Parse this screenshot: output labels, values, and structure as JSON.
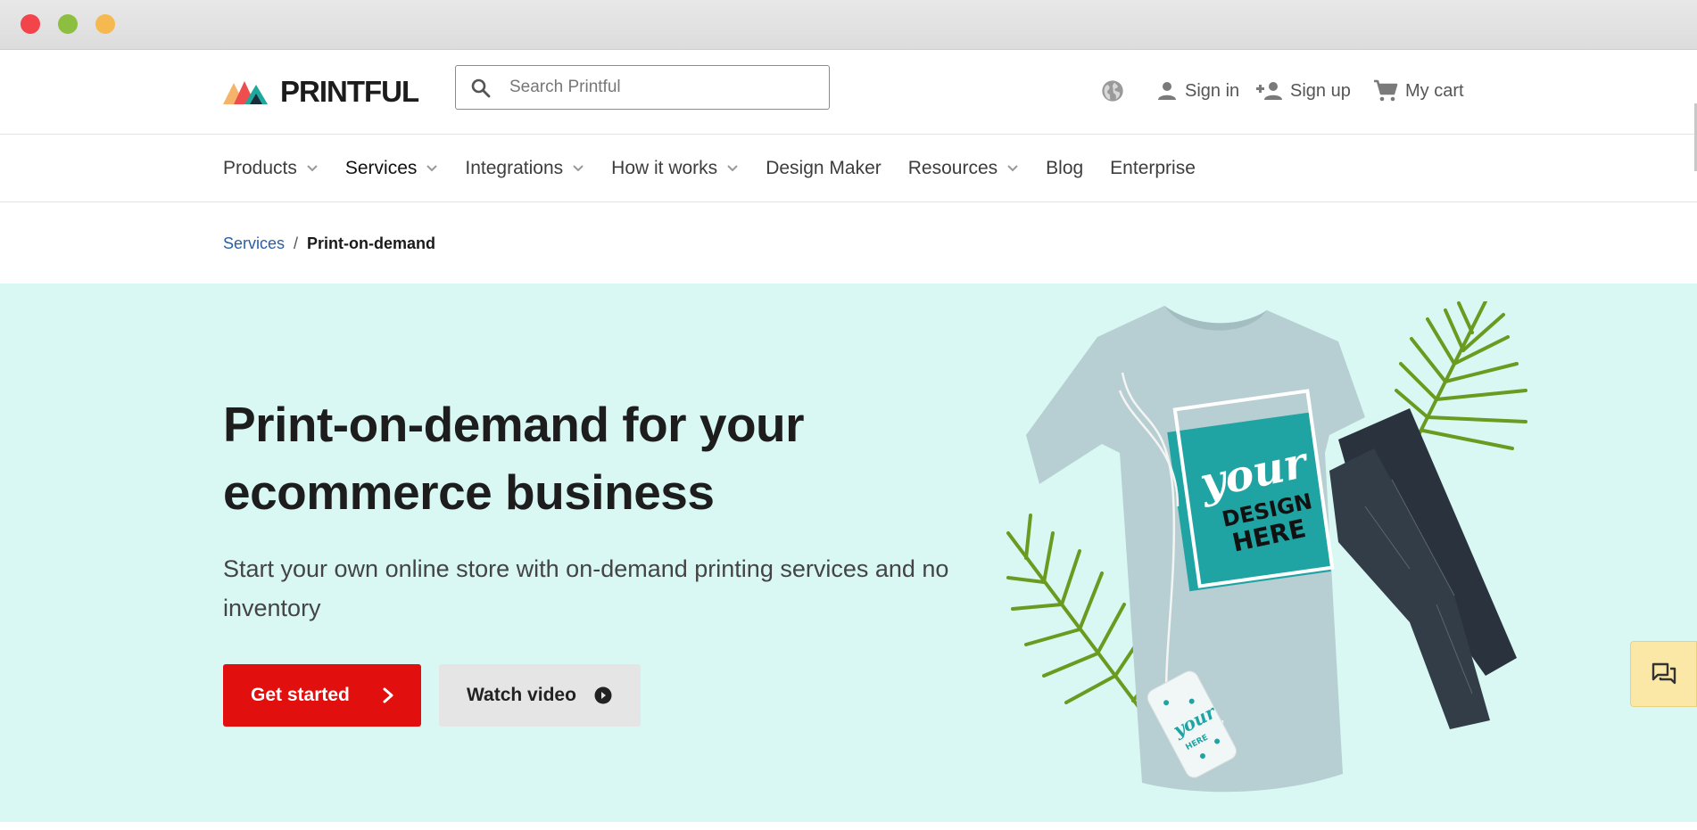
{
  "window": {
    "buttons": [
      "close",
      "minimize",
      "zoom"
    ]
  },
  "header": {
    "logo_text": "PRINTFUL",
    "search_placeholder": "Search Printful",
    "globe_icon": "globe-icon",
    "sign_in": "Sign in",
    "sign_up": "Sign up",
    "cart": "My cart"
  },
  "nav": {
    "items": [
      {
        "label": "Products",
        "dropdown": true
      },
      {
        "label": "Services",
        "dropdown": true
      },
      {
        "label": "Integrations",
        "dropdown": true
      },
      {
        "label": "How it works",
        "dropdown": true
      },
      {
        "label": "Design Maker",
        "dropdown": false
      },
      {
        "label": "Resources",
        "dropdown": true
      },
      {
        "label": "Blog",
        "dropdown": false
      },
      {
        "label": "Enterprise",
        "dropdown": false
      }
    ]
  },
  "breadcrumb": {
    "parent": "Services",
    "separator": "/",
    "current": "Print-on-demand"
  },
  "hero": {
    "title": "Print-on-demand for your ecommerce business",
    "subtitle": "Start your own online store with on-demand printing services and no inventory",
    "primary_cta": "Get started",
    "secondary_cta": "Watch video",
    "art": {
      "shirt_print_small": "your",
      "shirt_print_big": "DESIGN HERE"
    }
  },
  "colors": {
    "hero_bg": "#d9f8f4",
    "primary": "#e20f0f",
    "link": "#2a5ea6",
    "chat_bg": "#fbe8a6"
  }
}
